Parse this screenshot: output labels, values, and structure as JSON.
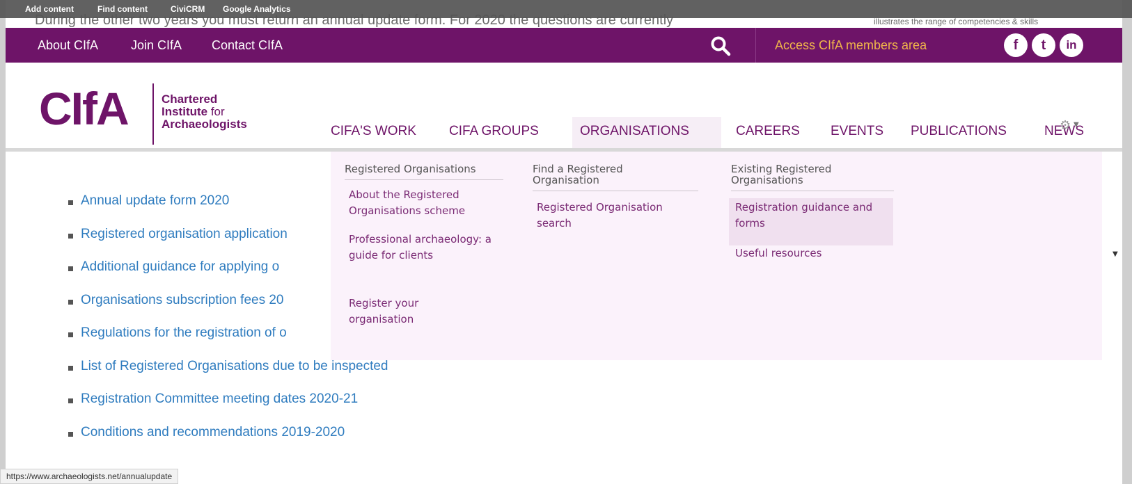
{
  "admin_bar": {
    "items": [
      "Add content",
      "Find content",
      "CiviCRM",
      "Google Analytics"
    ]
  },
  "background_text": {
    "left": "During the other two years you must return an annual update form. For 2020 the questions are currently",
    "right": "illustrates the range of competencies & skills"
  },
  "top_bar": {
    "links": [
      "About CIfA",
      "Join CIfA",
      "Contact CIfA"
    ],
    "members_link": "Access CIfA members area",
    "social": [
      {
        "icon": "facebook-icon",
        "glyph": "f"
      },
      {
        "icon": "twitter-icon",
        "glyph": "t"
      },
      {
        "icon": "linkedin-icon",
        "glyph": "in"
      }
    ],
    "bg_color": "#6e1468",
    "members_color": "#f0b54a"
  },
  "logo": {
    "mark": "CIfA",
    "line1": "Chartered",
    "line2_bold": "Institute",
    "line2_rest": " for",
    "line3": "Archaeologists"
  },
  "main_nav": {
    "items": [
      "CIFA'S WORK",
      "CIFA GROUPS",
      "ORGANISATIONS",
      "CAREERS",
      "EVENTS",
      "PUBLICATIONS",
      "NEWS"
    ],
    "active": "ORGANISATIONS"
  },
  "dropdown": {
    "columns": [
      {
        "heading": "Registered Organisations",
        "links": [
          "About the Registered Organisations scheme",
          "Professional archaeology: a guide for clients",
          "Register your organisation"
        ]
      },
      {
        "heading": "Find a Registered Organisation",
        "links": [
          "Registered Organisation search"
        ]
      },
      {
        "heading": "Existing Registered Organisations",
        "links": [
          "Registration guidance and forms",
          "Useful resources"
        ]
      }
    ]
  },
  "content_list": {
    "items": [
      "Annual update form 2020",
      "Registered organisation application",
      "Additional guidance for applying o",
      "Organisations subscription fees 20",
      "Regulations for the registration of o",
      "List of Registered Organisations due to be inspected",
      "Registration Committee meeting dates 2020-21",
      "Conditions and recommendations 2019-2020"
    ]
  },
  "status_bar": {
    "url": "https://www.archaeologists.net/annualupdate"
  },
  "colors": {
    "brand_purple": "#6e1468",
    "link_blue": "#2f7cbf",
    "dropdown_bg": "#fbf2fb"
  }
}
